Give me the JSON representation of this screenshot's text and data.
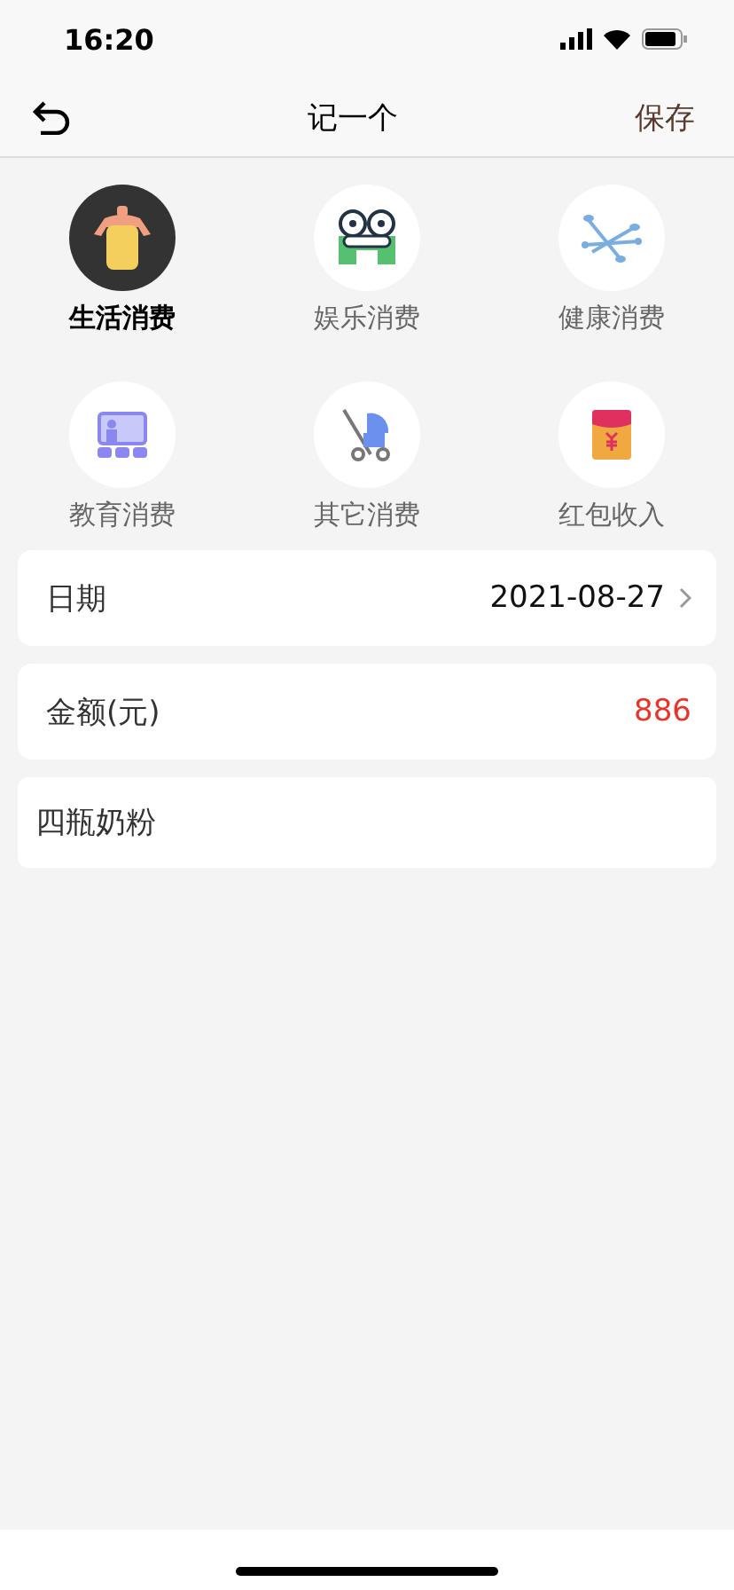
{
  "status_bar": {
    "time": "16:20"
  },
  "nav": {
    "title": "记一个",
    "action": "保存"
  },
  "categories": [
    {
      "label": "生活消费",
      "kind": "bottle",
      "selected": true
    },
    {
      "label": "娱乐消费",
      "kind": "frog",
      "selected": false
    },
    {
      "label": "健康消费",
      "kind": "swab",
      "selected": false
    },
    {
      "label": "教育消费",
      "kind": "teacher",
      "selected": false
    },
    {
      "label": "其它消费",
      "kind": "stroller",
      "selected": false
    },
    {
      "label": "红包收入",
      "kind": "envelope",
      "selected": false
    }
  ],
  "date_row": {
    "label": "日期",
    "value": "2021-08-27"
  },
  "amount_row": {
    "label": "金额(元)",
    "value": "886"
  },
  "note": {
    "value": "四瓶奶粉"
  }
}
